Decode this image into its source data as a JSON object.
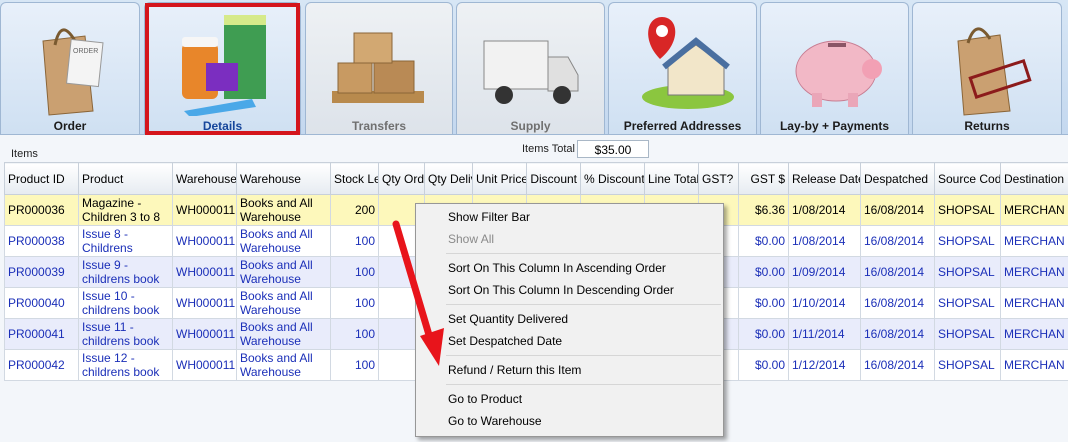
{
  "tabs": [
    {
      "label": "Order",
      "icon": "shopping-bag-order-icon",
      "dim": false,
      "active": false
    },
    {
      "label": "Details",
      "icon": "product-boxes-icon",
      "dim": false,
      "active": true
    },
    {
      "label": "Transfers",
      "icon": "pallet-boxes-icon",
      "dim": true,
      "active": false
    },
    {
      "label": "Supply",
      "icon": "delivery-truck-icon",
      "dim": true,
      "active": false
    },
    {
      "label": "Preferred Addresses",
      "icon": "house-location-pin-icon",
      "dim": false,
      "active": false
    },
    {
      "label": "Lay-by + Payments",
      "icon": "piggy-bank-icon",
      "dim": false,
      "active": false
    },
    {
      "label": "Returns",
      "icon": "rejected-bag-icon",
      "dim": false,
      "active": false
    }
  ],
  "items_section": {
    "title": "Items",
    "total_label": "Items Total",
    "total_value": "$35.00"
  },
  "columns": [
    {
      "label": "Product ID",
      "align": "l"
    },
    {
      "label": "Product",
      "align": "l"
    },
    {
      "label": "Warehouse ID",
      "align": "l"
    },
    {
      "label": "Warehouse",
      "align": "l"
    },
    {
      "label": "Stock Level",
      "align": "r"
    },
    {
      "label": "Qty Ordered",
      "align": "r"
    },
    {
      "label": "Qty Delivered",
      "align": "r"
    },
    {
      "label": "Unit Price",
      "align": "r"
    },
    {
      "label": "Discount",
      "align": "r"
    },
    {
      "label": "% Discount",
      "align": "r"
    },
    {
      "label": "Line Total",
      "align": "r"
    },
    {
      "label": "GST?",
      "align": "l"
    },
    {
      "label": "GST $",
      "align": "r"
    },
    {
      "label": "Release Date",
      "align": "l"
    },
    {
      "label": "Despatched",
      "align": "l"
    },
    {
      "label": "Source Code",
      "align": "l"
    },
    {
      "label": "Destination Code",
      "align": "l"
    }
  ],
  "rows": [
    [
      "PR000036",
      "Magazine - Children 3 to 8",
      "WH000011",
      "Books and All Warehouse",
      "200",
      "",
      "",
      "",
      "",
      "",
      "",
      "",
      "$6.36",
      "1/08/2014",
      "16/08/2014",
      "SHOPSAL",
      "MERCHAN"
    ],
    [
      "PR000038",
      "Issue 8 - Childrens",
      "WH000011",
      "Books and All Warehouse",
      "100",
      "",
      "",
      "",
      "",
      "",
      "",
      "",
      "$0.00",
      "1/08/2014",
      "16/08/2014",
      "SHOPSAL",
      "MERCHAN"
    ],
    [
      "PR000039",
      "Issue 9 - childrens book",
      "WH000011",
      "Books and All Warehouse",
      "100",
      "",
      "",
      "",
      "",
      "",
      "",
      "",
      "$0.00",
      "1/09/2014",
      "16/08/2014",
      "SHOPSAL",
      "MERCHAN"
    ],
    [
      "PR000040",
      "Issue 10 - childrens book",
      "WH000011",
      "Books and All Warehouse",
      "100",
      "",
      "",
      "",
      "",
      "",
      "",
      "",
      "$0.00",
      "1/10/2014",
      "16/08/2014",
      "SHOPSAL",
      "MERCHAN"
    ],
    [
      "PR000041",
      "Issue 11 - childrens book",
      "WH000011",
      "Books and All Warehouse",
      "100",
      "",
      "",
      "",
      "",
      "",
      "",
      "",
      "$0.00",
      "1/11/2014",
      "16/08/2014",
      "SHOPSAL",
      "MERCHAN"
    ],
    [
      "PR000042",
      "Issue 12 - childrens book",
      "WH000011",
      "Books and All Warehouse",
      "100",
      "",
      "",
      "",
      "",
      "",
      "",
      "",
      "$0.00",
      "1/12/2014",
      "16/08/2014",
      "SHOPSAL",
      "MERCHAN"
    ]
  ],
  "context_menu": [
    {
      "type": "item",
      "label": "Show Filter Bar",
      "disabled": false
    },
    {
      "type": "item",
      "label": "Show All",
      "disabled": true
    },
    {
      "type": "separator"
    },
    {
      "type": "item",
      "label": "Sort On This Column In Ascending Order",
      "disabled": false
    },
    {
      "type": "item",
      "label": "Sort On This Column In Descending Order",
      "disabled": false
    },
    {
      "type": "separator"
    },
    {
      "type": "item",
      "label": "Set Quantity Delivered",
      "disabled": false
    },
    {
      "type": "item",
      "label": "Set Despatched Date",
      "disabled": false
    },
    {
      "type": "separator"
    },
    {
      "type": "item",
      "label": "Refund / Return this Item",
      "disabled": false
    },
    {
      "type": "separator"
    },
    {
      "type": "item",
      "label": "Go to Product",
      "disabled": false
    },
    {
      "type": "item",
      "label": "Go to Warehouse",
      "disabled": false
    }
  ],
  "colors": {
    "selected_row": "#fdf8bb",
    "link_text": "#1b2fb8",
    "active_tab_border": "#d4151c",
    "annotation_arrow": "#e8141b"
  }
}
